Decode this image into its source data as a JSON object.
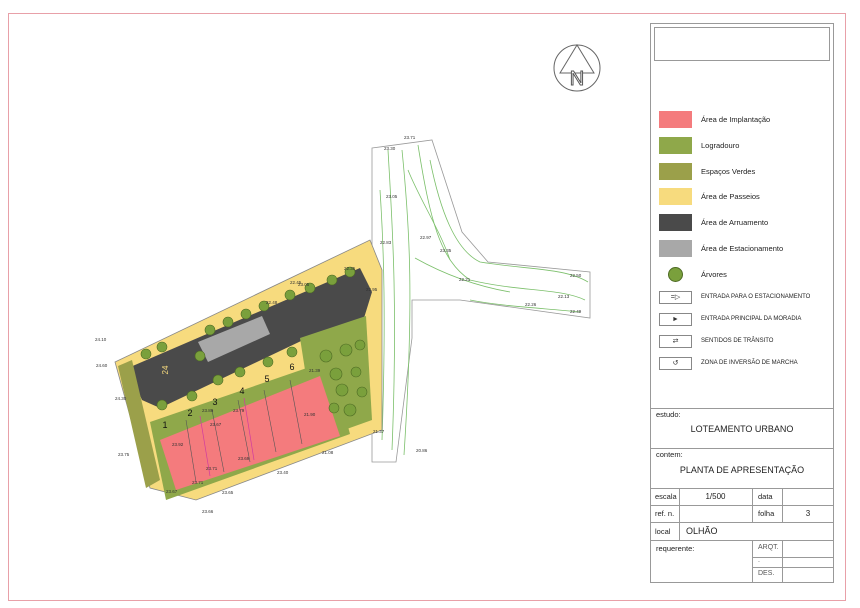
{
  "legend": [
    {
      "label": "Área de Implantação",
      "color": "#f47b7d"
    },
    {
      "label": "Logradouro",
      "color": "#8fa84a"
    },
    {
      "label": "Espaços Verdes",
      "color": "#9ba04a"
    },
    {
      "label": "Área de Passeios",
      "color": "#f7db7e"
    },
    {
      "label": "Área de Arruamento",
      "color": "#4a4a4a"
    },
    {
      "label": "Área de Estacionamento",
      "color": "#a8a8a8"
    },
    {
      "label": "Árvores",
      "color": "#7aa03c"
    }
  ],
  "symbols": [
    {
      "label": "ENTRADA PARA O ESTACIONAMENTO",
      "glyph": "=▷"
    },
    {
      "label": "ENTRADA PRINCIPAL DA MORADIA",
      "glyph": "►"
    },
    {
      "label": "SENTIDOS DE TRÂNSITO",
      "glyph": "⇄"
    },
    {
      "label": "ZONA DE INVERSÃO DE MARCHA",
      "glyph": "↺"
    }
  ],
  "titleblock": {
    "estudo_caption": "estudo:",
    "estudo_value": "LOTEAMENTO URBANO",
    "contem_caption": "contem:",
    "contem_value": "PLANTA DE APRESENTAÇÃO",
    "escala_caption": "escala",
    "escala_value": "1/500",
    "data_caption": "data",
    "ref_caption": "ref. n.",
    "folha_caption": "folha",
    "folha_value": "3",
    "local_caption": "local",
    "local_value": "OLHÃO",
    "requerente_caption": "requerente:",
    "arqt_caption": "ARQT.",
    "dot_caption": ".",
    "des_caption": "DES."
  },
  "plan": {
    "north_letter": "N",
    "lot_numbers": [
      "1",
      "2",
      "3",
      "4",
      "5",
      "6"
    ],
    "lot_big_label": "24",
    "elevations": [
      "24.10",
      "24.60",
      "24.30",
      "23.75",
      "23.67",
      "23.66",
      "23.65",
      "23.92",
      "23.71",
      "23.71",
      "23.67",
      "23.89",
      "23.79",
      "23.69",
      "23.40",
      "23.05",
      "21.08",
      "21.39",
      "21.90",
      "22.35",
      "22.45",
      "22.48",
      "22.83",
      "21.37",
      "22.95",
      "23.05",
      "23.71",
      "22.97",
      "23.35",
      "22.21",
      "22.50",
      "22.13",
      "22.26",
      "22.49",
      "20.86",
      "23.30"
    ]
  },
  "colors": {
    "implantacao": "#f47b7d",
    "logradouro": "#8fa84a",
    "espacos_verdes": "#9ba04a",
    "passeios": "#f7db7e",
    "arruamento": "#4a4a4a",
    "estacionamento": "#a8a8a8",
    "arvores": "#7aa03c",
    "contours": "#7bbf6a"
  }
}
